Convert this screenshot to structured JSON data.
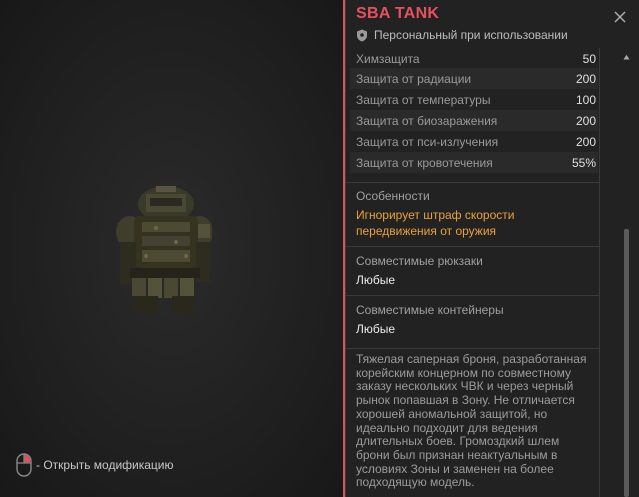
{
  "item": {
    "title": "SBA TANK",
    "binding": "Персональный при использовании",
    "image_icon": "armor-suit-image"
  },
  "stats": [
    {
      "label": "Химзащита",
      "value": "50"
    },
    {
      "label": "Защита от радиации",
      "value": "200"
    },
    {
      "label": "Защита от температуры",
      "value": "100"
    },
    {
      "label": "Защита от биозаражения",
      "value": "200"
    },
    {
      "label": "Защита от пси-излучения",
      "value": "200"
    },
    {
      "label": "Защита от кровотечения",
      "value": "55%"
    }
  ],
  "features": {
    "label": "Особенности",
    "value": "Игнорирует штраф скорости передвижения от оружия"
  },
  "backpacks": {
    "label": "Совместимые рюкзаки",
    "value": "Любые"
  },
  "containers": {
    "label": "Совместимые контейнеры",
    "value": "Любые"
  },
  "description": "Тяжелая саперная броня, разработанная корейским концерном по совместному заказу нескольких ЧВК и через черный рынок попавшая в Зону. Не отличается хорошей аномальной защитой, но идеально подходит для ведения длительных боев. Громоздкий шлем брони был признан неактуальным в условиях Зоны и заменен на более подходящую модель.",
  "hint": {
    "icon": "mouse-right-click-icon",
    "text": "- Открыть модификацию"
  },
  "colors": {
    "accent": "#e8505f",
    "feature": "#e8a23a"
  }
}
